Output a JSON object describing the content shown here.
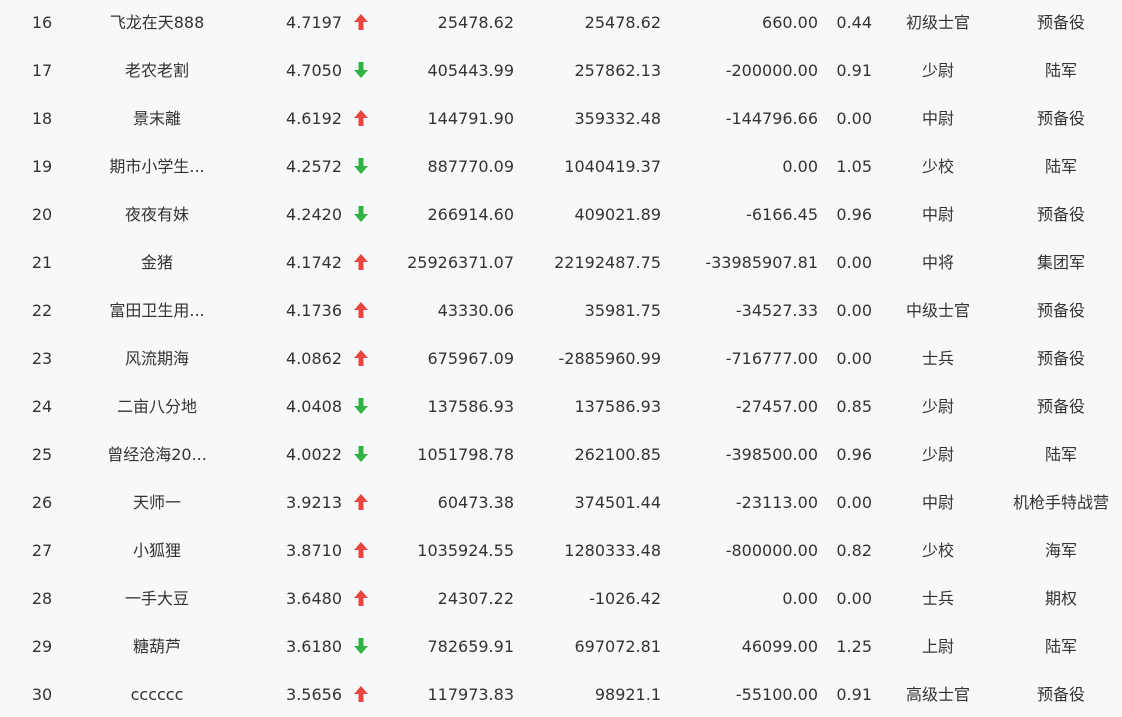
{
  "colors": {
    "up": "#e8473f",
    "down": "#2fb344",
    "text": "#333333",
    "background": "#f7f8fa"
  },
  "rows": [
    {
      "rank": "16",
      "name": "飞龙在天888",
      "score": "4.7197",
      "trend": "up",
      "v1": "25478.62",
      "v2": "25478.62",
      "v3": "660.00",
      "ratio": "0.44",
      "title": "初级士官",
      "unit": "预备役"
    },
    {
      "rank": "17",
      "name": "老农老割",
      "score": "4.7050",
      "trend": "down",
      "v1": "405443.99",
      "v2": "257862.13",
      "v3": "-200000.00",
      "ratio": "0.91",
      "title": "少尉",
      "unit": "陆军"
    },
    {
      "rank": "18",
      "name": "景末離",
      "score": "4.6192",
      "trend": "up",
      "v1": "144791.90",
      "v2": "359332.48",
      "v3": "-144796.66",
      "ratio": "0.00",
      "title": "中尉",
      "unit": "预备役"
    },
    {
      "rank": "19",
      "name": "期市小学生...",
      "score": "4.2572",
      "trend": "down",
      "v1": "887770.09",
      "v2": "1040419.37",
      "v3": "0.00",
      "ratio": "1.05",
      "title": "少校",
      "unit": "陆军"
    },
    {
      "rank": "20",
      "name": "夜夜有妹",
      "score": "4.2420",
      "trend": "down",
      "v1": "266914.60",
      "v2": "409021.89",
      "v3": "-6166.45",
      "ratio": "0.96",
      "title": "中尉",
      "unit": "预备役"
    },
    {
      "rank": "21",
      "name": "金猪",
      "score": "4.1742",
      "trend": "up",
      "v1": "25926371.07",
      "v2": "22192487.75",
      "v3": "-33985907.81",
      "ratio": "0.00",
      "title": "中将",
      "unit": "集团军"
    },
    {
      "rank": "22",
      "name": "富田卫生用...",
      "score": "4.1736",
      "trend": "up",
      "v1": "43330.06",
      "v2": "35981.75",
      "v3": "-34527.33",
      "ratio": "0.00",
      "title": "中级士官",
      "unit": "预备役"
    },
    {
      "rank": "23",
      "name": "风流期海",
      "score": "4.0862",
      "trend": "up",
      "v1": "675967.09",
      "v2": "-2885960.99",
      "v3": "-716777.00",
      "ratio": "0.00",
      "title": "士兵",
      "unit": "预备役"
    },
    {
      "rank": "24",
      "name": "二亩八分地",
      "score": "4.0408",
      "trend": "down",
      "v1": "137586.93",
      "v2": "137586.93",
      "v3": "-27457.00",
      "ratio": "0.85",
      "title": "少尉",
      "unit": "预备役"
    },
    {
      "rank": "25",
      "name": "曾经沧海20...",
      "score": "4.0022",
      "trend": "down",
      "v1": "1051798.78",
      "v2": "262100.85",
      "v3": "-398500.00",
      "ratio": "0.96",
      "title": "少尉",
      "unit": "陆军"
    },
    {
      "rank": "26",
      "name": "天师一",
      "score": "3.9213",
      "trend": "up",
      "v1": "60473.38",
      "v2": "374501.44",
      "v3": "-23113.00",
      "ratio": "0.00",
      "title": "中尉",
      "unit": "机枪手特战营"
    },
    {
      "rank": "27",
      "name": "小狐狸",
      "score": "3.8710",
      "trend": "up",
      "v1": "1035924.55",
      "v2": "1280333.48",
      "v3": "-800000.00",
      "ratio": "0.82",
      "title": "少校",
      "unit": "海军"
    },
    {
      "rank": "28",
      "name": "一手大豆",
      "score": "3.6480",
      "trend": "up",
      "v1": "24307.22",
      "v2": "-1026.42",
      "v3": "0.00",
      "ratio": "0.00",
      "title": "士兵",
      "unit": "期权"
    },
    {
      "rank": "29",
      "name": "糖葫芦",
      "score": "3.6180",
      "trend": "down",
      "v1": "782659.91",
      "v2": "697072.81",
      "v3": "46099.00",
      "ratio": "1.25",
      "title": "上尉",
      "unit": "陆军"
    },
    {
      "rank": "30",
      "name": "cccccc",
      "score": "3.5656",
      "trend": "up",
      "v1": "117973.83",
      "v2": "98921.1",
      "v3": "-55100.00",
      "ratio": "0.91",
      "title": "高级士官",
      "unit": "预备役"
    }
  ]
}
